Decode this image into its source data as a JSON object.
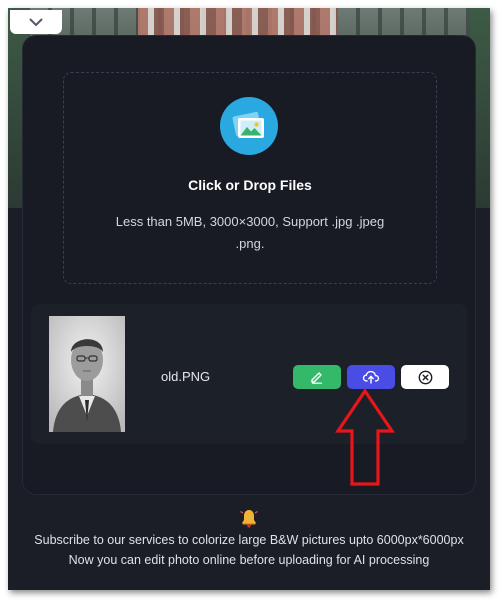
{
  "dropzone": {
    "title": "Click or Drop Files",
    "hint": "Less than 5MB, 3000×3000, Support .jpg .jpeg .png.",
    "icon": "image-gallery-icon"
  },
  "file": {
    "name": "old.PNG",
    "actions": [
      {
        "name": "edit",
        "icon": "pencil-icon",
        "color": "#34b96a"
      },
      {
        "name": "upload",
        "icon": "cloud-upload-icon",
        "color": "#4a4ce6"
      },
      {
        "name": "remove",
        "icon": "close-circle-icon",
        "color": "#ffffff"
      }
    ]
  },
  "footer": {
    "line1": "Subscribe to our services to colorize large B&W pictures upto 6000px*6000px",
    "line2": "Now you can edit photo online before uploading for AI processing",
    "icon": "bell-icon"
  },
  "colors": {
    "panel": "#181b23",
    "accent_upload": "#4a4ce6",
    "accent_edit": "#34b96a",
    "annotation": "#e8151b"
  }
}
